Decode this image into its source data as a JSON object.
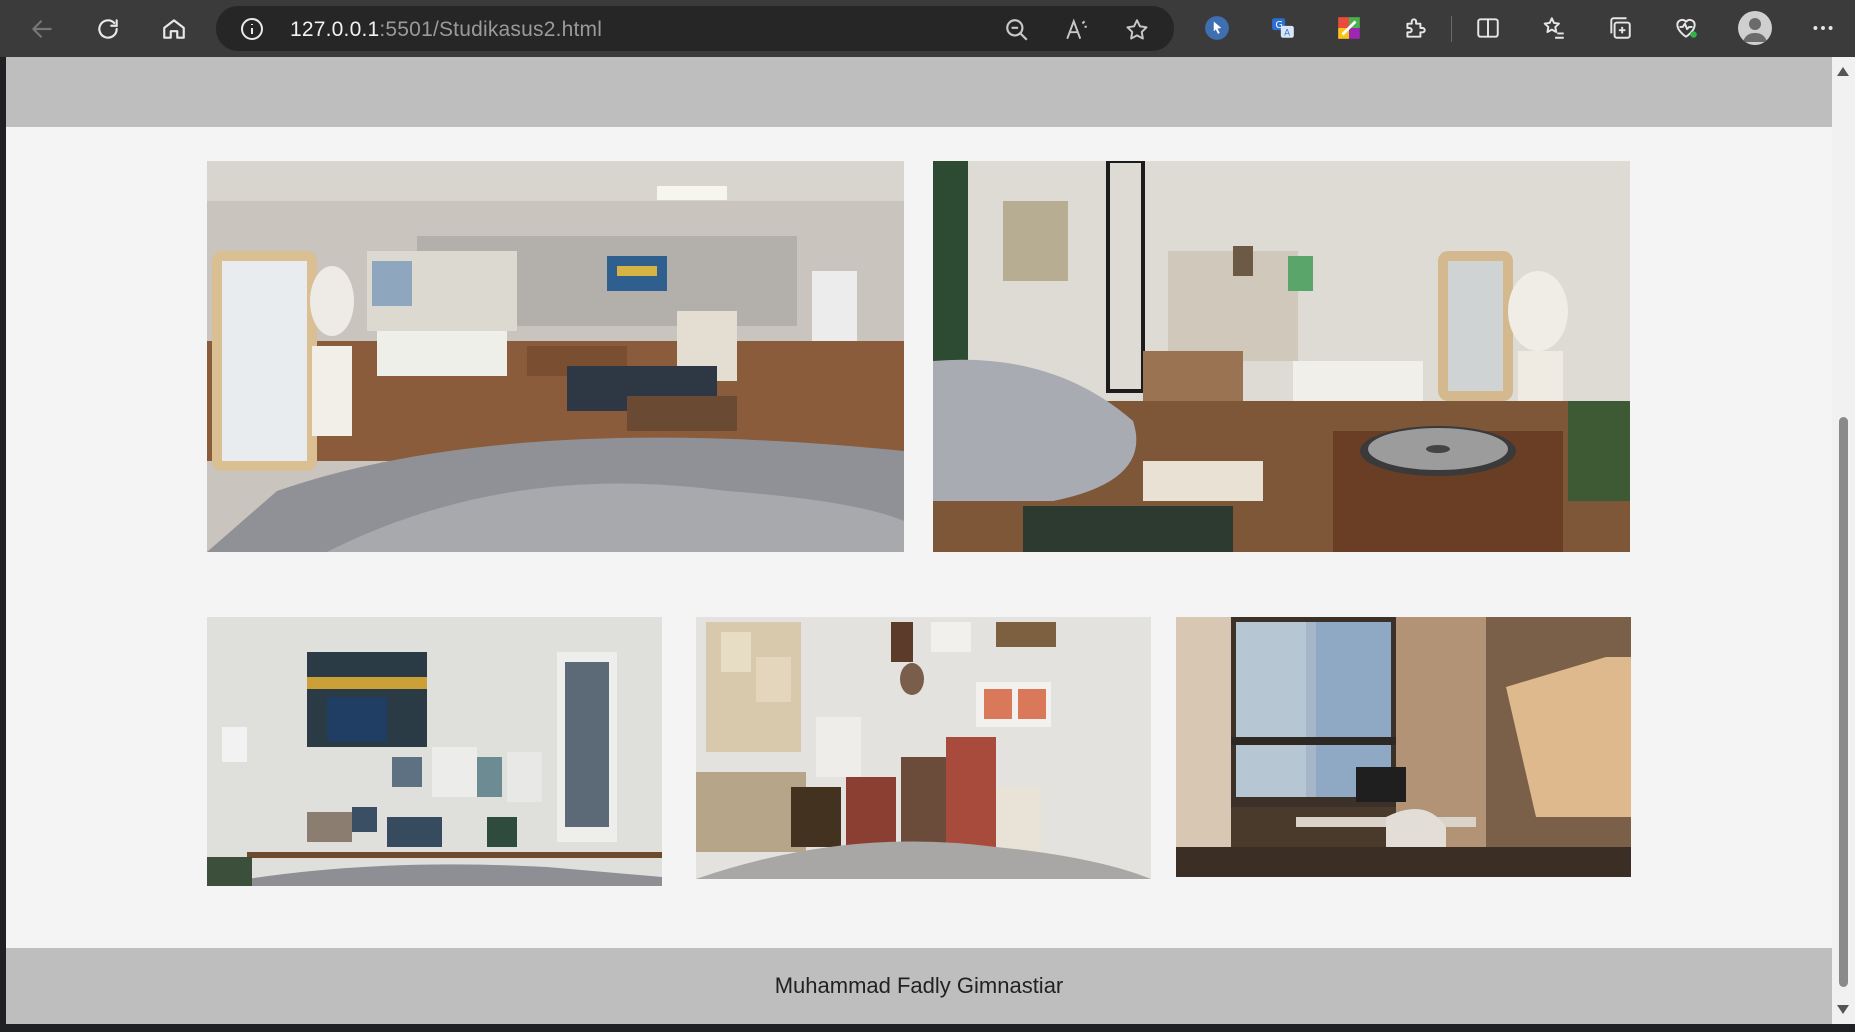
{
  "browser": {
    "url_host": "127.0.0.1",
    "url_rest": ":5501/Studikasus2.html",
    "icons": [
      "back-icon",
      "refresh-icon",
      "home-icon",
      "site-info-icon",
      "zoom-out-icon",
      "read-aloud-icon",
      "favorite-star-icon",
      "cursor-extension-icon",
      "translate-extension-icon",
      "colorful-extension-icon",
      "extensions-puzzle-icon",
      "split-screen-icon",
      "favorites-list-icon",
      "collections-icon",
      "browser-essentials-icon",
      "profile-avatar-icon",
      "more-menu-icon"
    ]
  },
  "page": {
    "footer_text": "Muhammad Fadly Gimnastiar",
    "background_color": "#f4f4f4",
    "bar_color": "#bebebe",
    "gallery": [
      {
        "name": "gallery-photo-living-room",
        "description_icon": "photo-icon"
      },
      {
        "name": "gallery-photo-bedroom-turntable",
        "description_icon": "photo-icon"
      },
      {
        "name": "gallery-photo-wall-art-shelf",
        "description_icon": "photo-icon"
      },
      {
        "name": "gallery-photo-book-stacks",
        "description_icon": "photo-icon"
      },
      {
        "name": "gallery-photo-window-sunlight",
        "description_icon": "photo-icon"
      }
    ]
  },
  "colors": {
    "chrome_bg": "#3b3b3b",
    "address_bg": "#262626",
    "url_host": "#f2f2f2",
    "url_rest": "#9a9a9a"
  }
}
